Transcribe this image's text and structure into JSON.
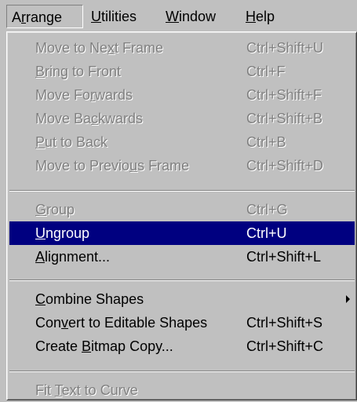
{
  "menubar": {
    "items": [
      {
        "label": "Arrange",
        "mnemonic_index": 1
      },
      {
        "label": "Utilities",
        "mnemonic_index": 0
      },
      {
        "label": "Window",
        "mnemonic_index": 0
      },
      {
        "label": "Help",
        "mnemonic_index": 0
      }
    ],
    "active": "Arrange"
  },
  "dropdown": {
    "groups": [
      [
        {
          "label": "Move to Next Frame",
          "mnemonic_index": 10,
          "shortcut": "Ctrl+Shift+U",
          "enabled": false
        },
        {
          "label": "Bring to Front",
          "mnemonic_index": 0,
          "shortcut": "Ctrl+F",
          "enabled": false
        },
        {
          "label": "Move Forwards",
          "mnemonic_index": 7,
          "shortcut": "Ctrl+Shift+F",
          "enabled": false
        },
        {
          "label": "Move Backwards",
          "mnemonic_index": 7,
          "shortcut": "Ctrl+Shift+B",
          "enabled": false
        },
        {
          "label": "Put to Back",
          "mnemonic_index": 0,
          "shortcut": "Ctrl+B",
          "enabled": false
        },
        {
          "label": "Move to Previous Frame",
          "mnemonic_index": 14,
          "shortcut": "Ctrl+Shift+D",
          "enabled": false
        }
      ],
      [
        {
          "label": "Group",
          "mnemonic_index": 0,
          "shortcut": "Ctrl+G",
          "enabled": false
        },
        {
          "label": "Ungroup",
          "mnemonic_index": 0,
          "shortcut": "Ctrl+U",
          "enabled": true,
          "highlighted": true
        },
        {
          "label": "Alignment...",
          "mnemonic_index": 0,
          "shortcut": "Ctrl+Shift+L",
          "enabled": true
        }
      ],
      [
        {
          "label": "Combine Shapes",
          "mnemonic_index": 0,
          "shortcut": "",
          "enabled": true,
          "submenu": true
        },
        {
          "label": "Convert to Editable Shapes",
          "mnemonic_index": 3,
          "shortcut": "Ctrl+Shift+S",
          "enabled": true
        },
        {
          "label": "Create Bitmap Copy...",
          "mnemonic_index": 7,
          "shortcut": "Ctrl+Shift+C",
          "enabled": true
        }
      ],
      [
        {
          "label": "Fit Text to Curve",
          "mnemonic_index": 4,
          "shortcut": "",
          "enabled": false
        }
      ]
    ]
  },
  "colors": {
    "menu_bg": "#c0c0c0",
    "highlight_bg": "#000080",
    "highlight_text": "#ffffff",
    "disabled_text": "#808080"
  }
}
